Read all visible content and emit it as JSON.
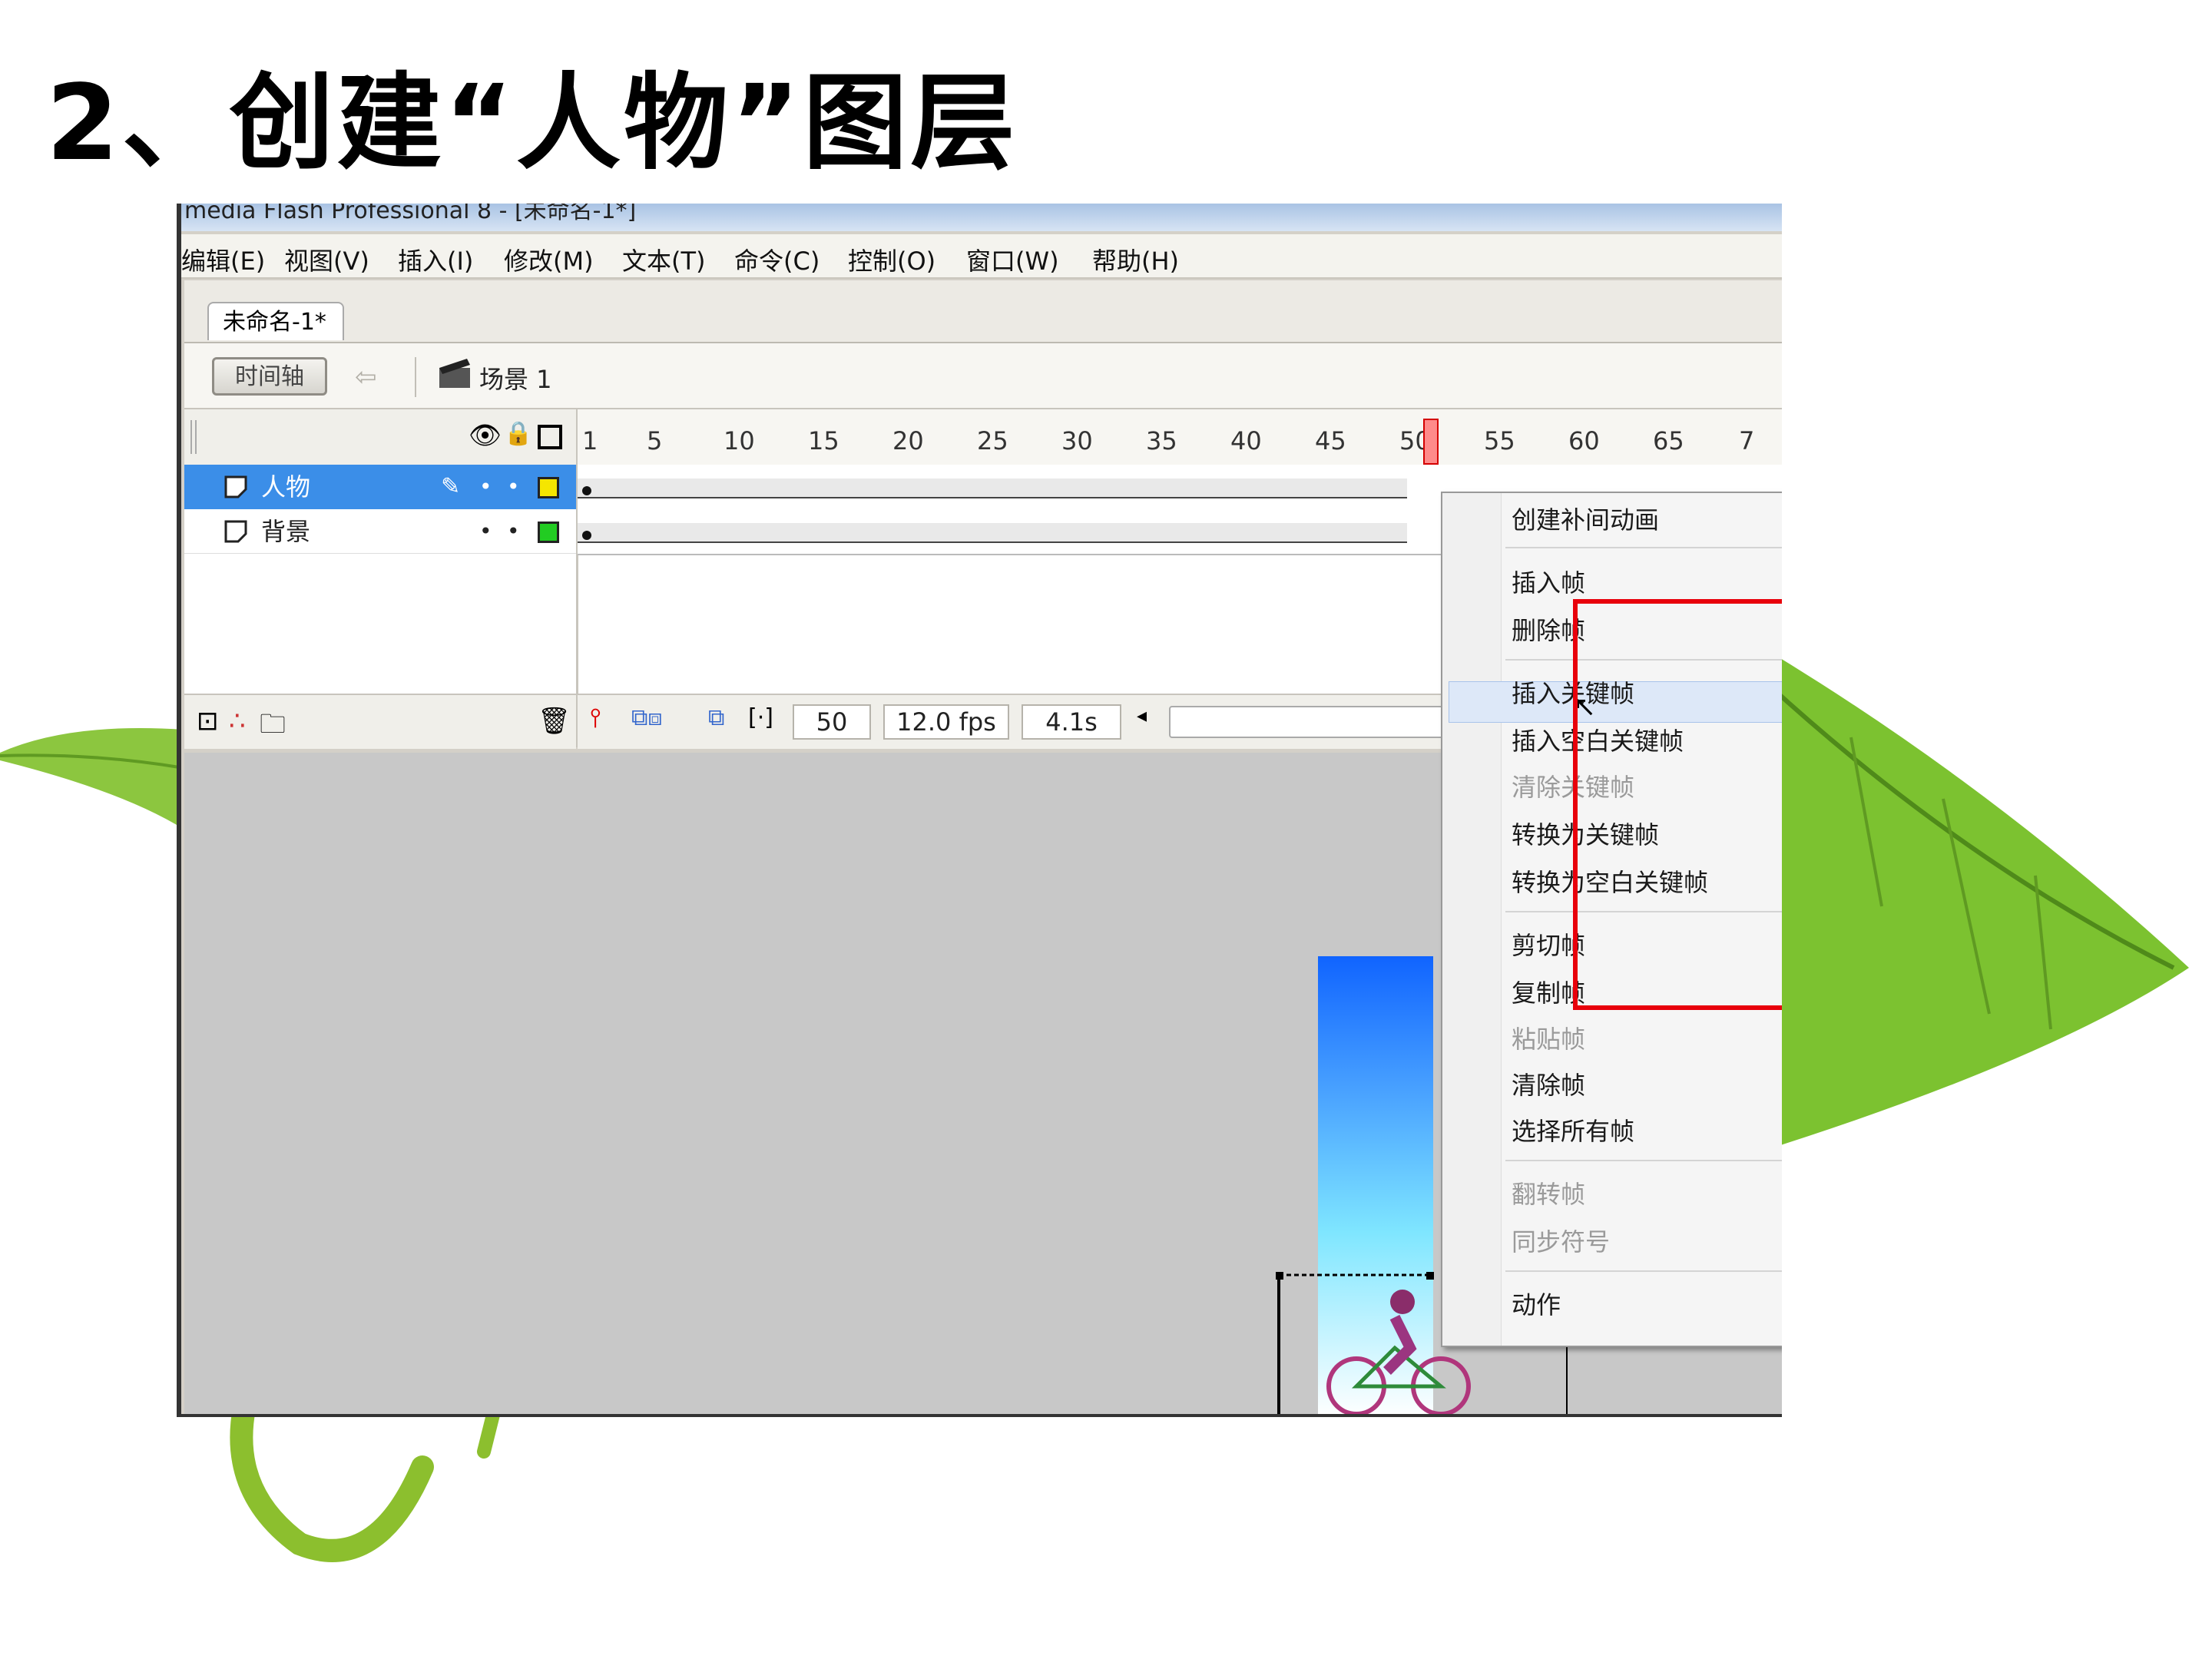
{
  "slide": {
    "title": "2、创建“人物”图层"
  },
  "window": {
    "title": "media Flash Professional 8 - [未命名-1*]",
    "menus": [
      "编辑(E)",
      "视图(V)",
      "插入(I)",
      "修改(M)",
      "文本(T)",
      "命令(C)",
      "控制(O)",
      "窗口(W)",
      "帮助(H)"
    ],
    "doc_tab": "未命名-1*"
  },
  "timeline": {
    "toggle_label": "时间轴",
    "scene_label": "场景 1",
    "ruler_ticks": [
      "1",
      "5",
      "10",
      "15",
      "20",
      "25",
      "30",
      "35",
      "40",
      "45",
      "50",
      "55",
      "60",
      "65",
      "7"
    ],
    "layers": [
      {
        "name": "人物",
        "selected": true,
        "color": "#f5e600"
      },
      {
        "name": "背景",
        "selected": false,
        "color": "#22cc22"
      }
    ],
    "current_frame": "50",
    "fps": "12.0 fps",
    "time": "4.1s",
    "selected_frame_number": 50
  },
  "context_menu": {
    "groups": [
      [
        {
          "label": "创建补间动画",
          "enabled": true
        }
      ],
      [
        {
          "label": "插入帧",
          "enabled": true
        },
        {
          "label": "删除帧",
          "enabled": true
        }
      ],
      [
        {
          "label": "插入关键帧",
          "enabled": true,
          "highlighted": true
        },
        {
          "label": "插入空白关键帧",
          "enabled": true
        },
        {
          "label": "清除关键帧",
          "enabled": false
        },
        {
          "label": "转换为关键帧",
          "enabled": true
        },
        {
          "label": "转换为空白关键帧",
          "enabled": true
        }
      ],
      [
        {
          "label": "剪切帧",
          "enabled": true
        },
        {
          "label": "复制帧",
          "enabled": true
        },
        {
          "label": "粘贴帧",
          "enabled": false
        },
        {
          "label": "清除帧",
          "enabled": true
        },
        {
          "label": "选择所有帧",
          "enabled": true
        }
      ],
      [
        {
          "label": "翻转帧",
          "enabled": false
        },
        {
          "label": "同步符号",
          "enabled": false
        }
      ],
      [
        {
          "label": "动作",
          "enabled": true
        }
      ]
    ]
  },
  "colors": {
    "highlight_box": "#e8000b",
    "layer_selected": "#3b8ee8",
    "leaf_green": "#7cc230"
  }
}
